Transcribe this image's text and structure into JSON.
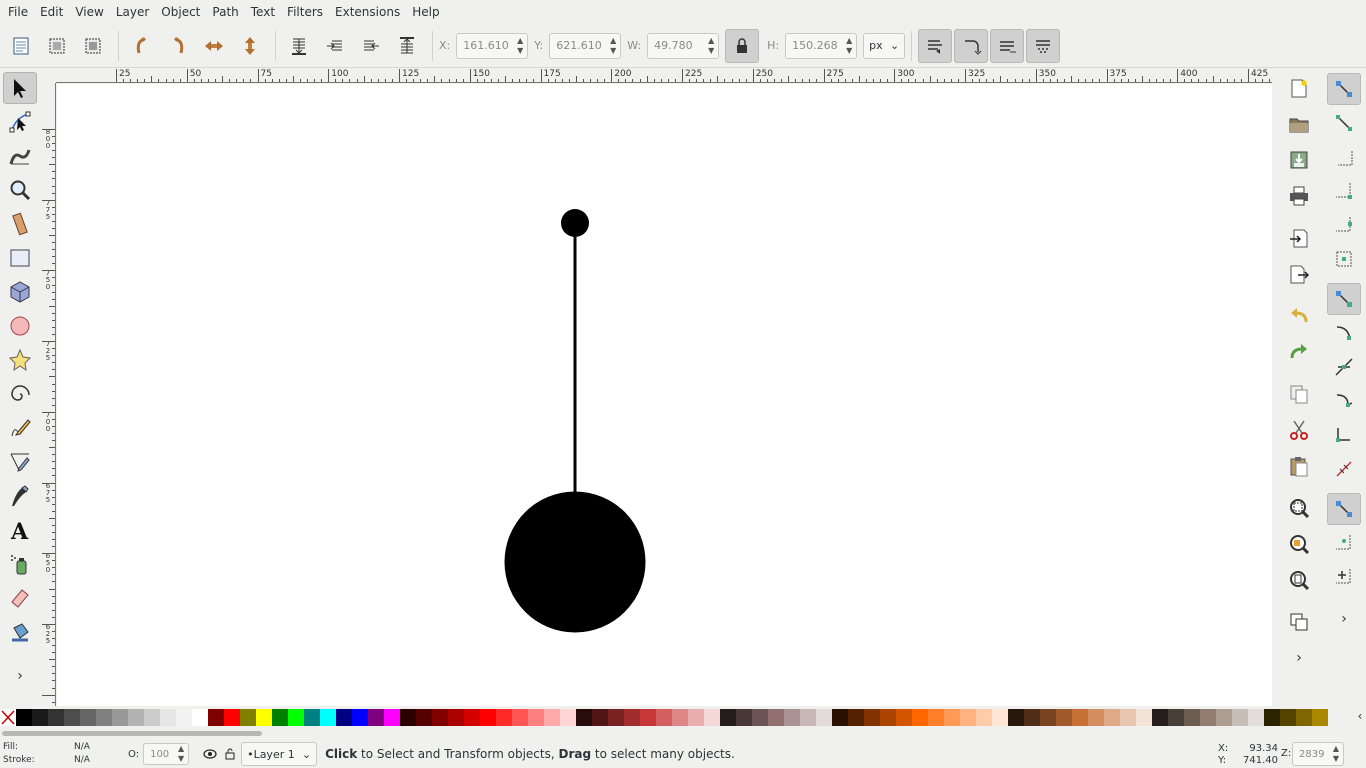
{
  "menu": [
    "File",
    "Edit",
    "View",
    "Layer",
    "Object",
    "Path",
    "Text",
    "Filters",
    "Extensions",
    "Help"
  ],
  "controls": {
    "x_label": "X:",
    "x_value": "161.610",
    "y_label": "Y:",
    "y_value": "621.610",
    "w_label": "W:",
    "w_value": "49.780",
    "h_label": "H:",
    "h_value": "150.268",
    "unit": "px"
  },
  "ruler_top": [
    "25",
    "50",
    "75",
    "100",
    "125",
    "150",
    "175",
    "200",
    "225",
    "250",
    "275",
    "300",
    "325",
    "350",
    "375",
    "400",
    "425"
  ],
  "ruler_left": [
    "800",
    "775",
    "750",
    "725",
    "700",
    "675",
    "650",
    "625"
  ],
  "palette": [
    "#000000",
    "#1a1a1a",
    "#333333",
    "#4d4d4d",
    "#666666",
    "#808080",
    "#999999",
    "#b3b3b3",
    "#cccccc",
    "#e6e6e6",
    "#f2f2f2",
    "#ffffff",
    "#800000",
    "#ff0000",
    "#808000",
    "#ffff00",
    "#008000",
    "#00ff00",
    "#008080",
    "#00ffff",
    "#000080",
    "#0000ff",
    "#800080",
    "#ff00ff",
    "#2b0000",
    "#550000",
    "#800000",
    "#aa0000",
    "#d40000",
    "#ff0000",
    "#ff2a2a",
    "#ff5555",
    "#ff8080",
    "#ffaaaa",
    "#ffd5d5",
    "#280b0b",
    "#501616",
    "#782121",
    "#a02c2c",
    "#c83737",
    "#d35f5f",
    "#de8787",
    "#e9afaf",
    "#f4d7d7",
    "#241c1c",
    "#483737",
    "#6c5353",
    "#916f6f",
    "#ac9393",
    "#c8b7b7",
    "#e3dbdb",
    "#2b1100",
    "#552200",
    "#803300",
    "#aa4400",
    "#d45500",
    "#ff6600",
    "#ff7f2a",
    "#ff9955",
    "#ffb380",
    "#ffccaa",
    "#ffe6d5",
    "#28170b",
    "#502d16",
    "#784421",
    "#a05a2c",
    "#c87137",
    "#d38d5f",
    "#deaa87",
    "#e9c6af",
    "#f4e3d7",
    "#241f1c",
    "#483e37",
    "#6c5d53",
    "#917c6f",
    "#ac9d93",
    "#c8beb7",
    "#e3dedb",
    "#2b2200",
    "#554400",
    "#806600",
    "#aa8800"
  ],
  "status": {
    "fill_label": "Fill:",
    "fill_value": "N/A",
    "stroke_label": "Stroke:",
    "stroke_value": "N/A",
    "opacity_label": "O:",
    "opacity_value": "100",
    "layer": "•Layer 1",
    "msg_click": "Click",
    "msg_mid": " to Select and Transform objects, ",
    "msg_drag": "Drag",
    "msg_end": " to select many objects.",
    "cx_label": "X:",
    "cx_value": "93.34",
    "cy_label": "Y:",
    "cy_value": "741.40",
    "zoom_label": "Z:",
    "zoom_value": "2839"
  },
  "colors": {
    "accent_pressed": "#cfd0cf",
    "canvas": "#ffffff",
    "shape": "#000000"
  }
}
